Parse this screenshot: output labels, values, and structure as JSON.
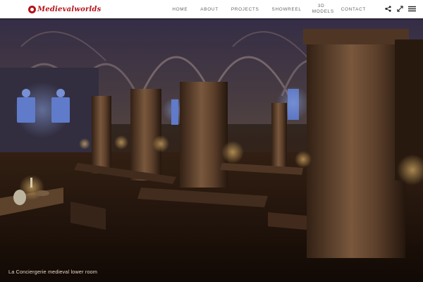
{
  "header": {
    "logo_text": "Medievalworlds",
    "nav": [
      {
        "label": "HOME"
      },
      {
        "label": "ABOUT"
      },
      {
        "label": "PROJECTS"
      },
      {
        "label": "SHOWREEL"
      },
      {
        "label": "3D MODELS"
      },
      {
        "label": "CONTACT"
      }
    ],
    "tools": [
      "share-icon",
      "fullscreen-icon",
      "menu-icon"
    ]
  },
  "hero": {
    "caption": "La Conciergerie medieval lower room"
  },
  "colors": {
    "brand": "#b3131b",
    "nav_text": "#666666",
    "caption_text": "#e8d9c4"
  }
}
